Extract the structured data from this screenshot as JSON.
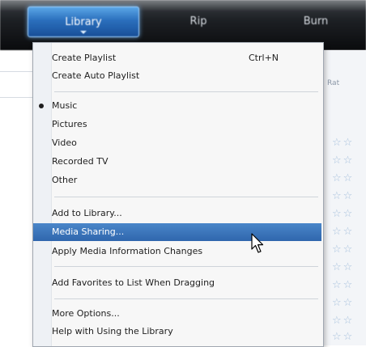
{
  "toolbar": {
    "tabs": [
      {
        "label": "Library"
      },
      {
        "label": "Rip"
      },
      {
        "label": "Burn"
      }
    ]
  },
  "background": {
    "column_header": "Rat"
  },
  "menu": {
    "items": [
      {
        "label": "Create Playlist",
        "shortcut": "Ctrl+N"
      },
      {
        "label": "Create Auto Playlist"
      },
      {
        "label": "Music",
        "selected": true
      },
      {
        "label": "Pictures"
      },
      {
        "label": "Video"
      },
      {
        "label": "Recorded TV"
      },
      {
        "label": "Other"
      },
      {
        "label": "Add to Library..."
      },
      {
        "label": "Media Sharing...",
        "highlighted": true
      },
      {
        "label": "Apply Media Information Changes"
      },
      {
        "label": "Add Favorites to List When Dragging"
      },
      {
        "label": "More Options..."
      },
      {
        "label": "Help with Using the Library"
      }
    ]
  },
  "colors": {
    "highlight": "#2f66ad",
    "toolbar": "#1d2024",
    "library_tab": "#2b6fbd",
    "star": "#a9c2dd"
  },
  "icons": {
    "star": "star-icon",
    "cursor": "mouse-pointer-icon"
  }
}
